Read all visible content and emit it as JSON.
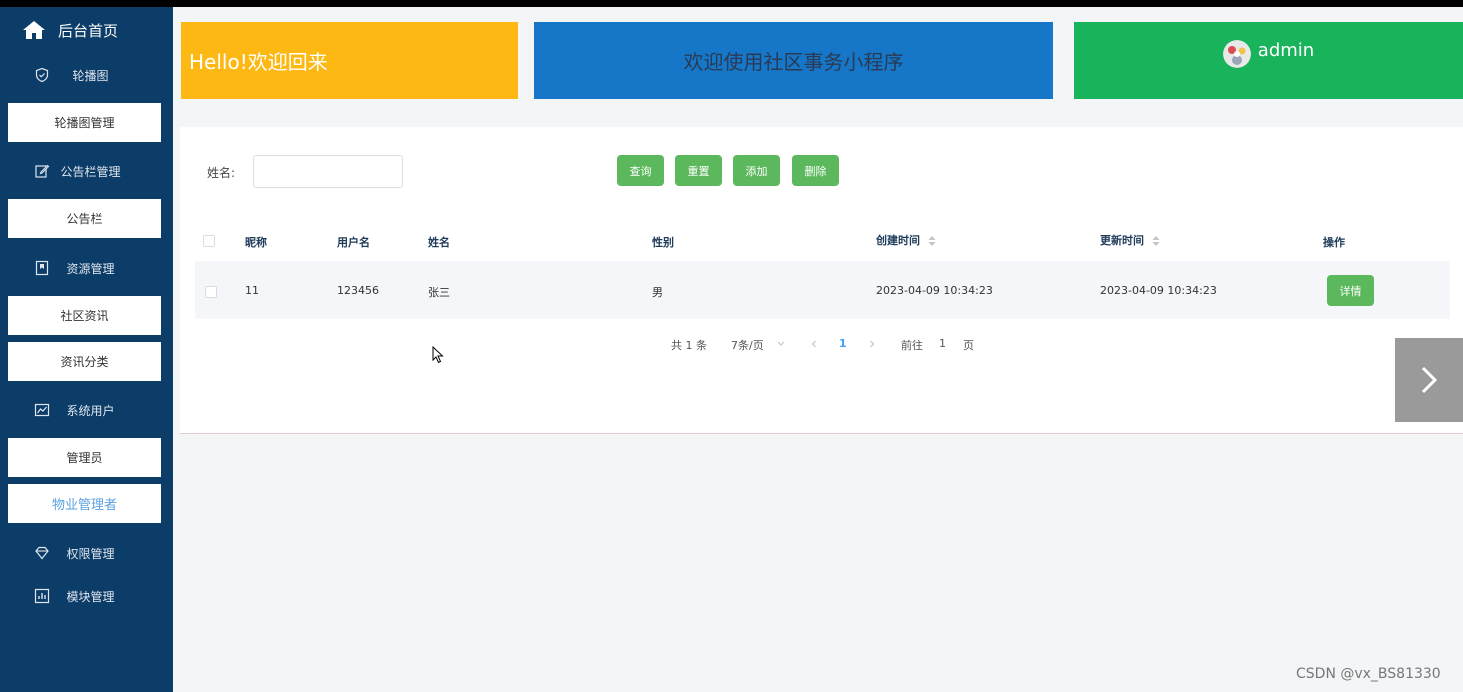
{
  "sidebar": {
    "home_label": "后台首页",
    "groups": [
      {
        "label": "轮播图",
        "icon": "shield-icon",
        "items": [
          "轮播图管理"
        ]
      },
      {
        "label": "公告栏管理",
        "icon": "edit-icon",
        "items": [
          "公告栏"
        ]
      },
      {
        "label": "资源管理",
        "icon": "bookmark-icon",
        "items": [
          "社区资讯",
          "资讯分类"
        ]
      },
      {
        "label": "系统用户",
        "icon": "chart-icon",
        "items": [
          "管理员",
          "物业管理者"
        ]
      },
      {
        "label": "权限管理",
        "icon": "diamond-icon",
        "items": []
      },
      {
        "label": "模块管理",
        "icon": "bar-chart-icon",
        "items": []
      }
    ],
    "active_item": "物业管理者"
  },
  "banner": {
    "hello": "Hello!欢迎回来",
    "welcome": "欢迎使用社区事务小程序",
    "username": "admin"
  },
  "search": {
    "name_label": "姓名:",
    "name_value": "",
    "buttons": {
      "query": "查询",
      "reset": "重置",
      "add": "添加",
      "delete": "删除"
    }
  },
  "table": {
    "columns": [
      "昵称",
      "用户名",
      "姓名",
      "性别",
      "创建时间",
      "更新时间",
      "操作"
    ],
    "rows": [
      {
        "nickname": "11",
        "username": "123456",
        "name": "张三",
        "gender": "男",
        "created": "2023-04-09 10:34:23",
        "updated": "2023-04-09 10:34:23",
        "action": "详情"
      }
    ]
  },
  "pagination": {
    "total": "共 1 条",
    "page_size": "7条/页",
    "current_page": "1",
    "goto_prefix": "前往",
    "goto_value": "1",
    "goto_suffix": "页"
  },
  "watermark": "CSDN @vx_BS81330",
  "colors": {
    "sidebar": "#0c3c68",
    "hello_card": "#fdb813",
    "welcome_card": "#1677c8",
    "user_card": "#19b35b",
    "button": "#5cb85c",
    "active_text": "#5aa2e0"
  }
}
